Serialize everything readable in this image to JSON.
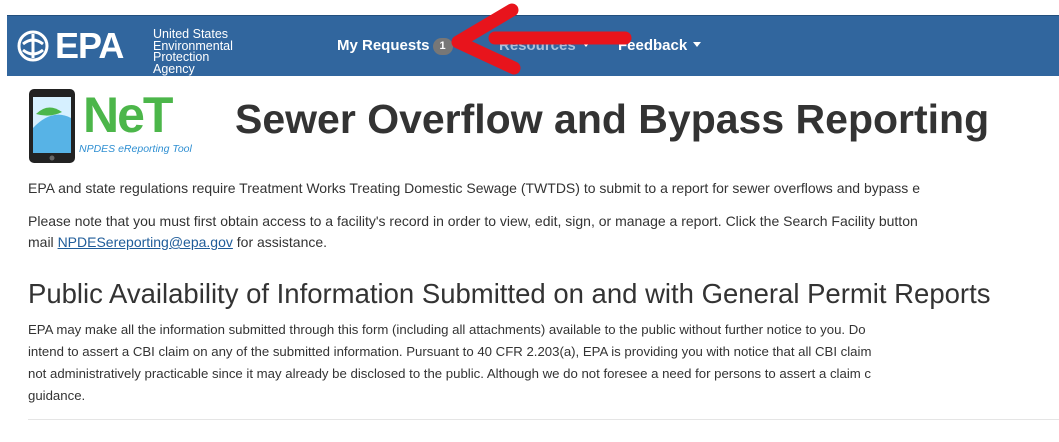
{
  "navbar": {
    "brand": "EPA",
    "agency_line1": "United States",
    "agency_line2": "Environmental Protection",
    "agency_line3": "Agency",
    "items": [
      {
        "label": "My Requests",
        "badge": "1"
      },
      {
        "label": "Resources"
      },
      {
        "label": "Feedback"
      }
    ]
  },
  "net_logo": {
    "word": "NeT",
    "subtitle": "NPDES eReporting Tool"
  },
  "page_title": "Sewer Overflow and Bypass Reporting",
  "intro": {
    "line1": "EPA and state regulations require Treatment Works Treating Domestic Sewage (TWTDS) to submit to a report for sewer overflows and bypass e",
    "line2": "Please note that you must first obtain access to a facility's record in order to view, edit, sign, or manage a report. Click the Search Facility button",
    "line3_prefix": "mail ",
    "email": "NPDESereporting@epa.gov",
    "line3_suffix": " for assistance."
  },
  "section": {
    "heading": "Public Availability of Information Submitted on and with General Permit Reports",
    "lines": [
      "EPA may make all the information submitted through this form (including all attachments) available to the public without further notice to you. Do",
      "intend to assert a CBI claim on any of the submitted information. Pursuant to 40 CFR 2.203(a), EPA is providing you with notice that all CBI claim",
      "not administratively practicable since it may already be disclosed to the public. Although we do not foresee a need for persons to assert a claim c",
      "guidance."
    ]
  },
  "colors": {
    "navbar": "#31669e",
    "arrow": "#e8141c",
    "net_green": "#4cb64a",
    "link": "#1f5c99"
  }
}
